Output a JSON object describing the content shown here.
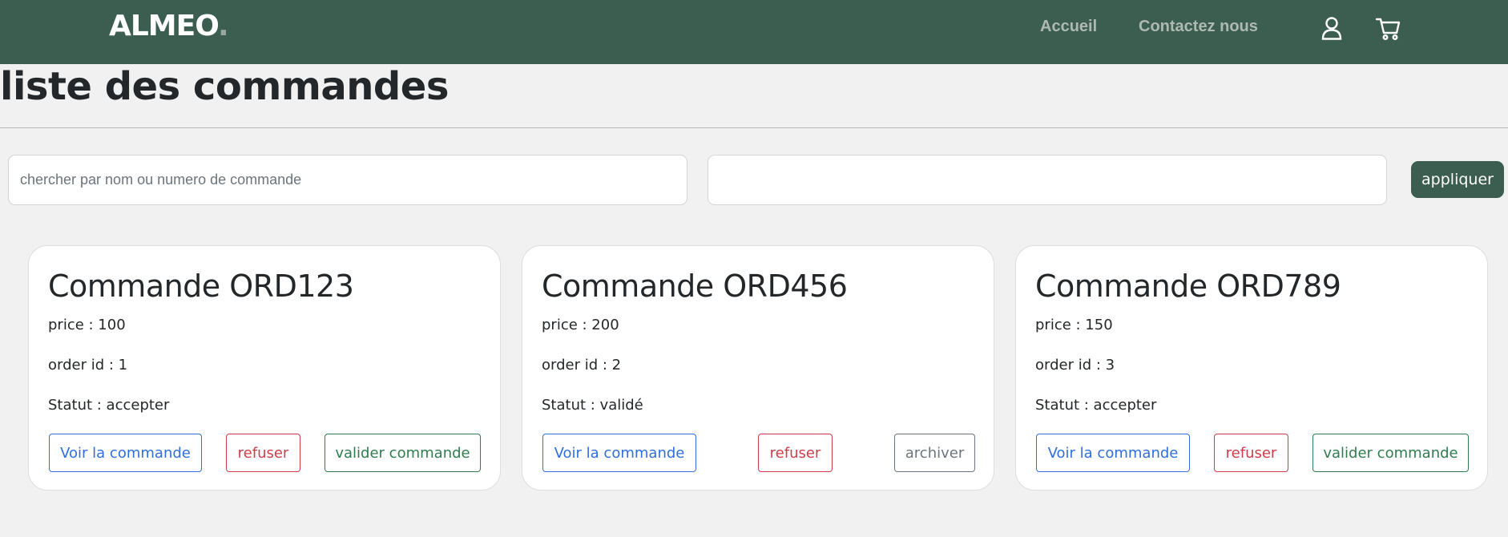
{
  "header": {
    "brand": "ALMEO",
    "brand_dot": ".",
    "nav": [
      {
        "label": "Accueil"
      },
      {
        "label": "Contactez nous"
      }
    ]
  },
  "page": {
    "title": "liste des commandes"
  },
  "filters": {
    "search_placeholder": "chercher par nom ou numero de commande",
    "search_value": "",
    "second_value": "",
    "apply_label": "appliquer"
  },
  "orders": [
    {
      "title": "Commande ORD123",
      "price": "price : 100",
      "order_id": "order id : 1",
      "status": "Statut : accepter",
      "btn_view": "Voir la commande",
      "btn_refuse": "refuser",
      "btn_third": "valider commande"
    },
    {
      "title": "Commande ORD456",
      "price": "price : 200",
      "order_id": "order id : 2",
      "status": "Statut : validé",
      "btn_view": "Voir la commande",
      "btn_refuse": "refuser",
      "btn_third": "archiver"
    },
    {
      "title": "Commande ORD789",
      "price": "price : 150",
      "order_id": "order id : 3",
      "status": "Statut : accepter",
      "btn_view": "Voir la commande",
      "btn_refuse": "refuser",
      "btn_third": "valider commande"
    }
  ],
  "icons": {
    "account": "user-icon",
    "cart": "cart-icon"
  },
  "colors": {
    "navbar": "#3c5e50",
    "apply_button": "#3c5e50",
    "view_button": "#2f6fdc",
    "refuse_button": "#cc3d4a",
    "validate_button": "#2f7d4f",
    "archive_button": "#6c757d"
  }
}
